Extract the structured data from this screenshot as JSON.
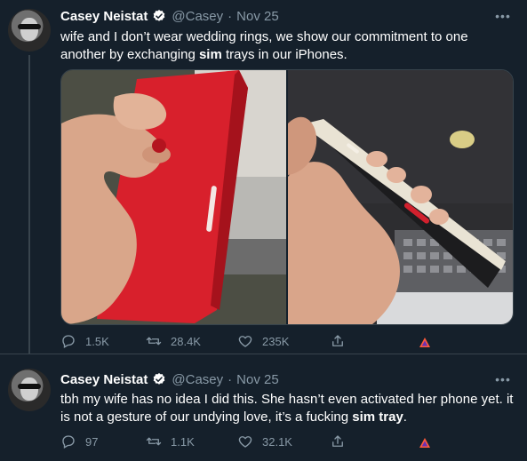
{
  "tweets": [
    {
      "author_name": "Casey Neistat",
      "handle": "@Casey",
      "separator": "·",
      "date": "Nov 25",
      "text_parts": [
        {
          "t": "wife and I don’t wear wedding rings, we show our commitment to one another by exchanging ",
          "bold": false
        },
        {
          "t": "sim",
          "bold": true
        },
        {
          "t": " trays in our iPhones.",
          "bold": false
        }
      ],
      "stats": {
        "replies": "1.5K",
        "retweets": "28.4K",
        "likes": "235K"
      }
    },
    {
      "author_name": "Casey Neistat",
      "handle": "@Casey",
      "separator": "·",
      "date": "Nov 25",
      "text_parts": [
        {
          "t": "tbh my wife has no idea I did this.  She hasn’t even activated her phone yet. it is not a gesture of our undying love, it’s a fucking ",
          "bold": false
        },
        {
          "t": "sim tray",
          "bold": true
        },
        {
          "t": ".",
          "bold": false
        }
      ],
      "stats": {
        "replies": "97",
        "retweets": "1.1K",
        "likes": "32.1K"
      }
    }
  ],
  "icons": {
    "reply": "reply-icon",
    "retweet": "retweet-icon",
    "like": "heart-icon",
    "share": "share-icon",
    "more": "more-icon",
    "verified": "verified-badge-icon",
    "extension": "brave-icon"
  },
  "colors": {
    "background": "#15202b",
    "secondary_text": "#8899a6",
    "divider": "#38444d",
    "verified_badge": "#ffffff",
    "iphone_red": "#e01e2a",
    "iphone_white": "#e8e4da"
  }
}
